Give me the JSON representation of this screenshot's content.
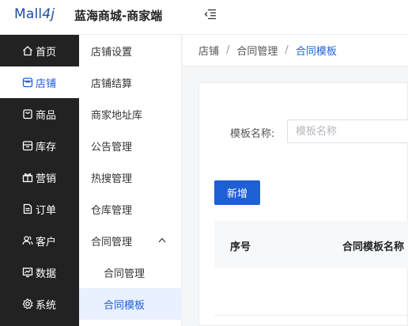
{
  "header": {
    "logo_text": "Mall4j",
    "logo_prefix": "Mall",
    "logo_suffix": "4j",
    "brand_title": "蓝海商城-商家端",
    "fold_icon": "menu-fold-icon"
  },
  "sidebar": {
    "items": [
      {
        "label": "首页",
        "icon": "home-icon"
      },
      {
        "label": "店铺",
        "icon": "shop-icon"
      },
      {
        "label": "商品",
        "icon": "product-icon"
      },
      {
        "label": "库存",
        "icon": "inventory-icon"
      },
      {
        "label": "营销",
        "icon": "gift-icon"
      },
      {
        "label": "订单",
        "icon": "order-icon"
      },
      {
        "label": "客户",
        "icon": "customer-icon"
      },
      {
        "label": "数据",
        "icon": "chart-icon"
      },
      {
        "label": "系统",
        "icon": "gear-icon"
      }
    ],
    "active_index": 1
  },
  "submenu": {
    "items": [
      {
        "label": "店铺设置"
      },
      {
        "label": "店铺结算"
      },
      {
        "label": "商家地址库"
      },
      {
        "label": "公告管理"
      },
      {
        "label": "热搜管理"
      },
      {
        "label": "仓库管理"
      },
      {
        "label": "合同管理"
      },
      {
        "label": "合同管理"
      },
      {
        "label": "合同模板"
      }
    ],
    "expanded_group_icon": "chevron-up-icon",
    "active_index": 8
  },
  "breadcrumb": {
    "items": [
      "店铺",
      "合同管理",
      "合同模板"
    ],
    "separator": "/"
  },
  "search": {
    "label": "模板名称:",
    "placeholder": "模板名称",
    "value": ""
  },
  "toolbar": {
    "add_label": "新增"
  },
  "table": {
    "columns": [
      "序号",
      "合同模板名称"
    ]
  },
  "colors": {
    "accent": "#1f5fd6",
    "sidebar_bg": "#222222",
    "submenu_active_bg": "#e9f0ff"
  }
}
